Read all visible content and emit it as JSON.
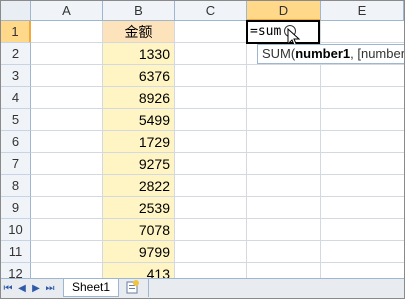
{
  "columns": [
    "A",
    "B",
    "C",
    "D",
    "E"
  ],
  "rows": [
    "1",
    "2",
    "3",
    "4",
    "5",
    "6",
    "7",
    "8",
    "9",
    "10",
    "11",
    "12"
  ],
  "cells": {
    "B1": "金额",
    "B_values": [
      "1330",
      "6376",
      "8926",
      "5499",
      "1729",
      "9275",
      "2822",
      "2539",
      "7078",
      "9799",
      "413"
    ]
  },
  "formula_input": "=sum",
  "tooltip": {
    "func": "SUM(",
    "arg1": "number1",
    "rest": ", [number"
  },
  "sheet_tab": "Sheet1",
  "colors": {
    "highlight_column": "#fff5c4",
    "header_cell": "#fde3bb",
    "active_header": "#ffd88a"
  }
}
